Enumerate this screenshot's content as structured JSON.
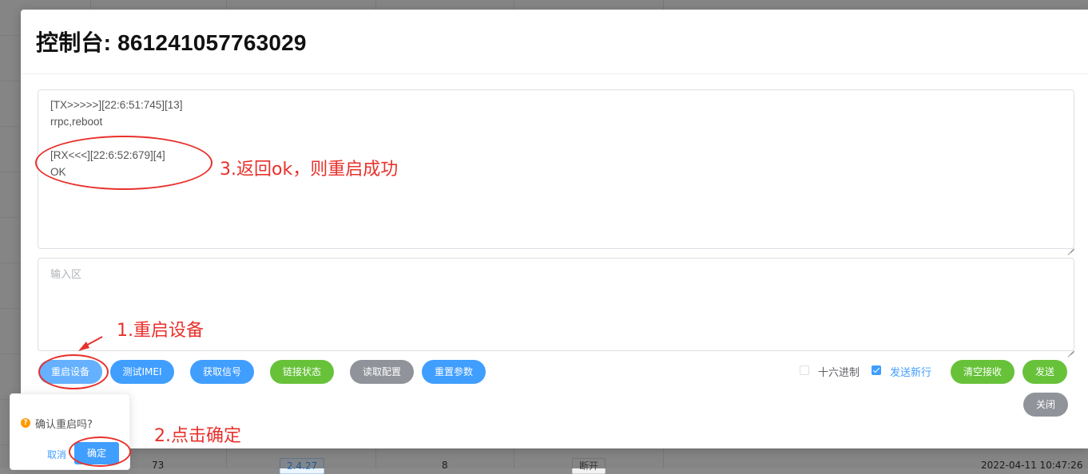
{
  "background": {
    "row": {
      "number": "73",
      "version": "2.4.27",
      "count": "8",
      "status": "断开",
      "timestamp": "2022-04-11 10:47:26"
    }
  },
  "dialog": {
    "title": "控制台: 861241057763029",
    "receive_log": "[TX>>>>>][22:6:51:745][13]\nrrpc,reboot\n\n[RX<<<][22:6:52:679][4]\nOK",
    "input_placeholder": "输入区",
    "buttons": {
      "restart": "重启设备",
      "test_imei": "测试IMEI",
      "get_signal": "获取信号",
      "link_status": "链接状态",
      "read_config": "读取配置",
      "reset_params": "重置参数",
      "clear_receive": "清空接收",
      "send": "发送",
      "close": "关闭"
    },
    "options": {
      "hex_label": "十六进制",
      "hex_checked": false,
      "newline_label": "发送新行",
      "newline_checked": true
    }
  },
  "popconfirm": {
    "icon": "question-icon",
    "message": "确认重启吗?",
    "cancel": "取消",
    "confirm": "确定"
  },
  "annotations": {
    "step1": "1.重启设备",
    "step2": "2.点击确定",
    "step3": "3.返回ok，则重启成功",
    "color": "#e8312c"
  }
}
